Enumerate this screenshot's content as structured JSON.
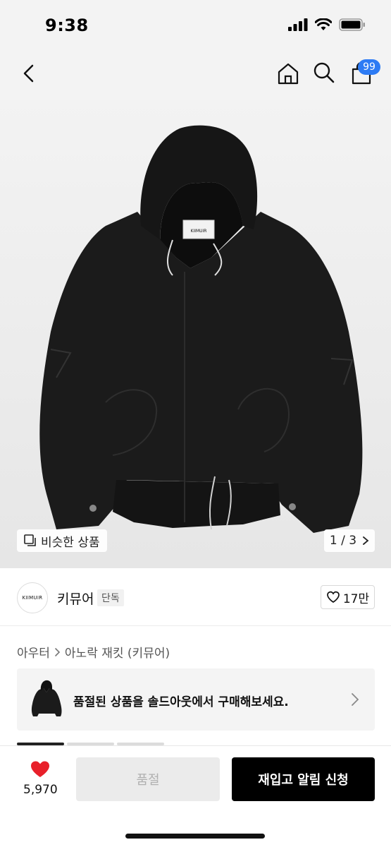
{
  "status_bar": {
    "time": "9:38",
    "icons": [
      "cellular-signal-icon",
      "wifi-icon",
      "battery-icon"
    ]
  },
  "nav": {
    "back_icon": "chevron-left-icon",
    "home_icon": "home-icon",
    "search_icon": "search-icon",
    "cart_icon": "shopping-bag-icon",
    "cart_badge": "99",
    "badge_color": "#2d7bf4"
  },
  "product_image": {
    "label_text": "KIIMUIR",
    "similar_label": "비슷한 상품",
    "similar_icon": "copy-icon",
    "pager": "1 / 3",
    "pager_icon": "chevron-right-icon"
  },
  "brand": {
    "logo_text": "KIIMUIR",
    "name": "키뮤어",
    "tag": "단독",
    "like_icon": "heart-outline-icon",
    "like_count": "17만"
  },
  "breadcrumb": {
    "category": "아우터",
    "separator_icon": "chevron-right-icon",
    "subcategory": "아노락 재킷 (키뮤어)"
  },
  "soldout_banner": {
    "text": "품절된 상품을 솔드아웃에서 구매해보세요.",
    "chevron_icon": "chevron-right-icon"
  },
  "thumb_tabs": [
    "active",
    "inactive",
    "inactive"
  ],
  "bottom_bar": {
    "heart_icon": "heart-filled-icon",
    "heart_color": "#e8202a",
    "heart_count": "5,970",
    "soldout_label": "품절",
    "restock_label": "재입고 알림 신청"
  }
}
